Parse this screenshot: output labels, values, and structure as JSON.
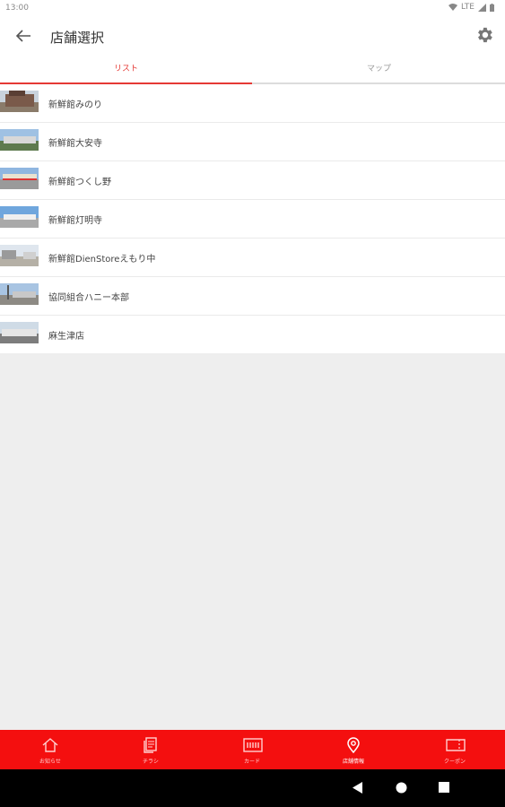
{
  "status": {
    "time": "13:00",
    "network": "LTE"
  },
  "appbar": {
    "title": "店舗選択"
  },
  "tabs": [
    {
      "label": "リスト",
      "active": true
    },
    {
      "label": "マップ",
      "active": false
    }
  ],
  "stores": [
    {
      "name": "新鮮館みのり"
    },
    {
      "name": "新鮮館大安寺"
    },
    {
      "name": "新鮮館つくし野"
    },
    {
      "name": "新鮮館灯明寺"
    },
    {
      "name": "新鮮館DienStoreえもり中"
    },
    {
      "name": "協同組合ハニー本部"
    },
    {
      "name": "麻生津店"
    }
  ],
  "bottom_nav": [
    {
      "label": "お知らせ",
      "icon": "home-icon",
      "active": false
    },
    {
      "label": "チラシ",
      "icon": "flyer-icon",
      "active": false
    },
    {
      "label": "カード",
      "icon": "card-icon",
      "active": false
    },
    {
      "label": "店舗情報",
      "icon": "location-pin-icon",
      "active": true
    },
    {
      "label": "クーポン",
      "icon": "coupon-icon",
      "active": false
    }
  ],
  "colors": {
    "accent": "#e53935",
    "nav_bar": "#f40f0f",
    "background": "#eeeeee"
  }
}
